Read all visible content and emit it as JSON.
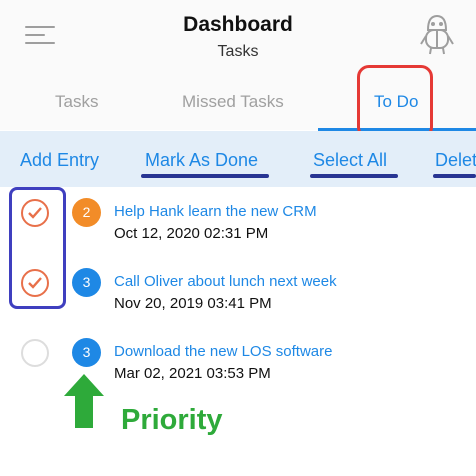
{
  "header": {
    "title": "Dashboard",
    "subtitle": "Tasks"
  },
  "tabs": [
    {
      "label": "Tasks",
      "active": false
    },
    {
      "label": "Missed Tasks",
      "active": false
    },
    {
      "label": "To Do",
      "active": true
    }
  ],
  "actions": [
    {
      "label": "Add Entry"
    },
    {
      "label": "Mark As Done"
    },
    {
      "label": "Select All"
    },
    {
      "label": "Delete"
    }
  ],
  "tasks": [
    {
      "title": "Help Hank learn the new CRM",
      "date": "Oct 12, 2020 02:31 PM",
      "priority": "2",
      "priority_color": "#f28c28",
      "checked": true
    },
    {
      "title": "Call Oliver about lunch next week",
      "date": "Nov 20, 2019 03:41 PM",
      "priority": "3",
      "priority_color": "#1e88e5",
      "checked": true
    },
    {
      "title": "Download the new LOS software",
      "date": "Mar 02, 2021 03:53 PM",
      "priority": "3",
      "priority_color": "#1e88e5",
      "checked": false
    }
  ],
  "annotation": {
    "label": "Priority",
    "color": "#2eaa3a"
  },
  "colors": {
    "accent": "#1e88e5",
    "check": "#e8704a",
    "red_box": "#e53935",
    "blue_box": "#3f3fbf",
    "underline": "#283593"
  }
}
